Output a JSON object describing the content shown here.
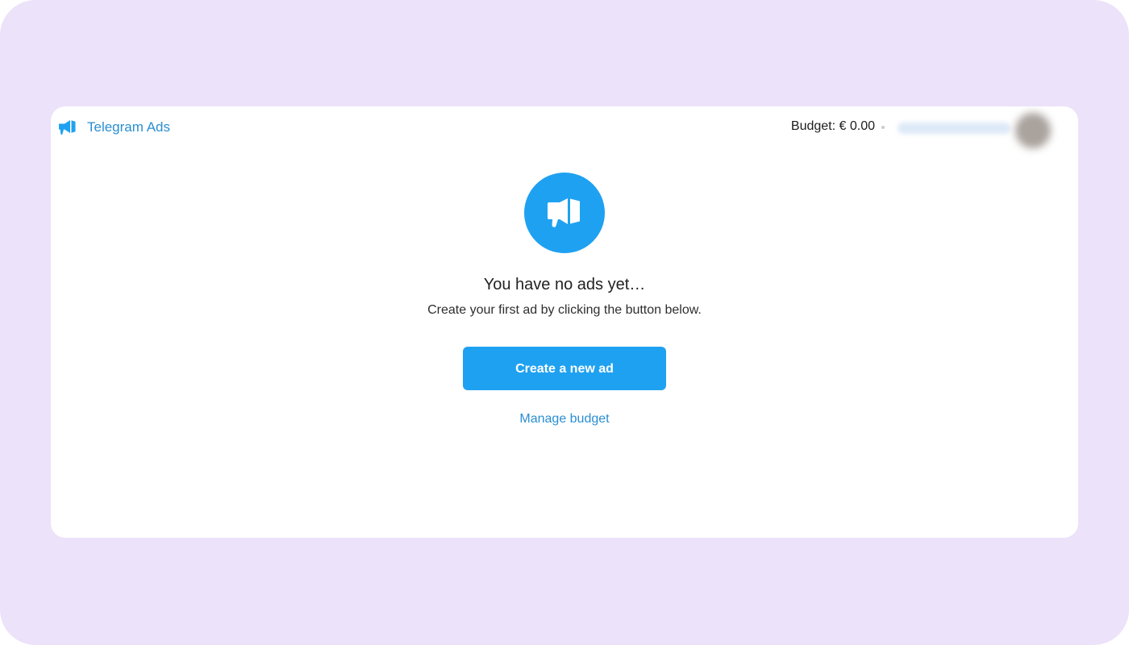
{
  "header": {
    "logo_text": "Telegram Ads",
    "budget_text": "Budget: € 0.00"
  },
  "empty_state": {
    "title": "You have no ads yet…",
    "subtitle": "Create your first ad by clicking the button below.",
    "create_button_label": "Create a new ad",
    "manage_budget_label": "Manage budget"
  },
  "icons": {
    "logo": "megaphone-icon",
    "hero": "megaphone-icon"
  },
  "colors": {
    "background": "#ece2fa",
    "accent": "#1fa1f1",
    "link": "#2a8ed1"
  }
}
